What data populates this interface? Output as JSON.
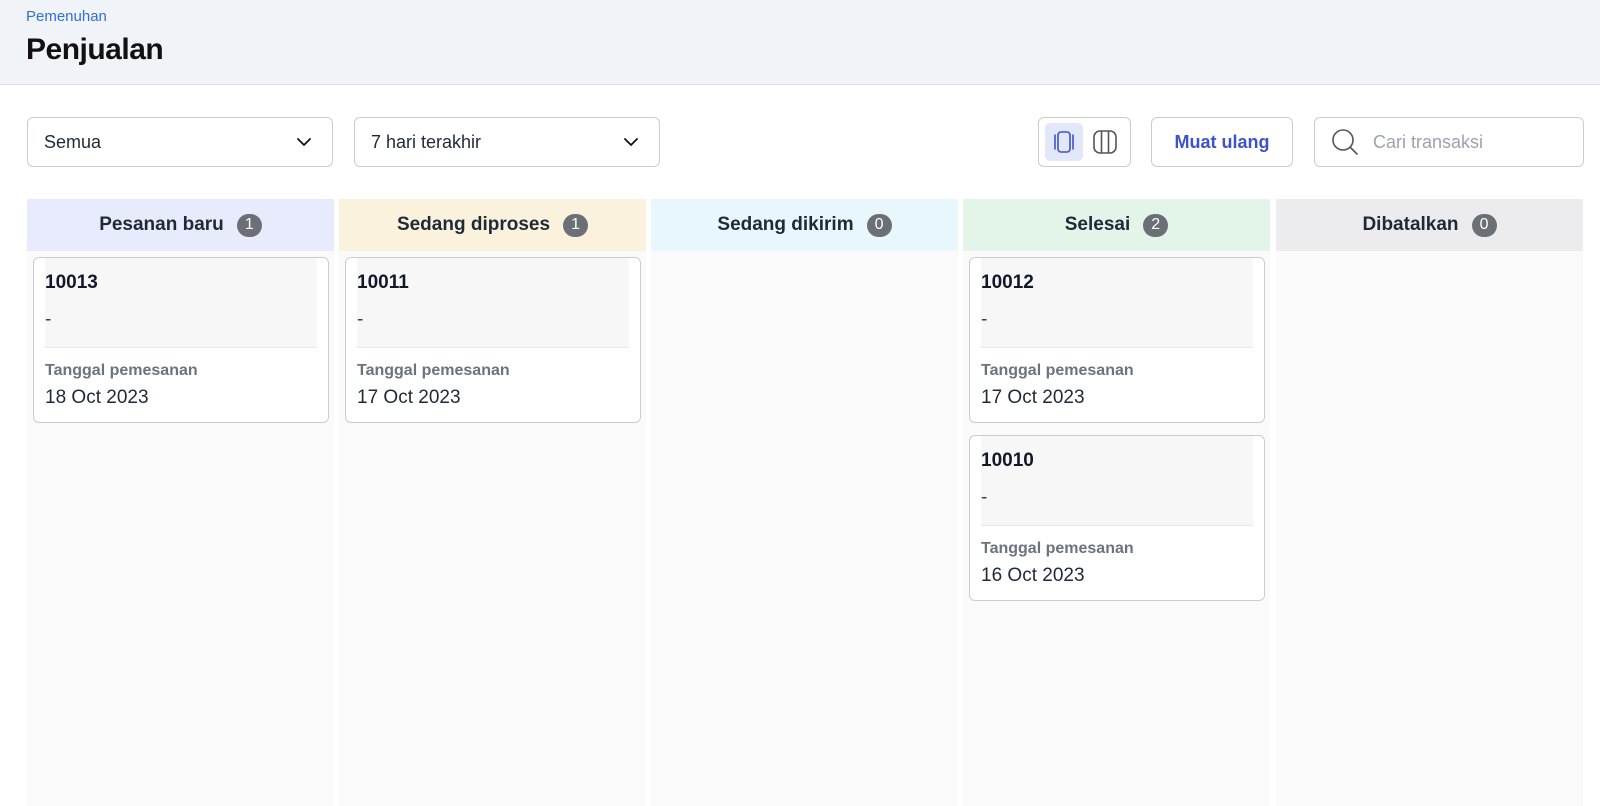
{
  "header": {
    "breadcrumb": "Pemenuhan",
    "title": "Penjualan"
  },
  "toolbar": {
    "status_filter": "Semua",
    "date_filter": "7 hari terakhir",
    "reload_label": "Muat ulang",
    "search_placeholder": "Cari transaksi",
    "view_modes": [
      {
        "icon": "card-view-icon",
        "active": true
      },
      {
        "icon": "column-view-icon",
        "active": false
      }
    ]
  },
  "colors": {
    "accent": "#3d53c9",
    "link": "#2f6fe0",
    "new": "#e8ebfc",
    "processing": "#fbf2de",
    "shipping": "#e8f7fb",
    "done": "#e3f4e8",
    "cancelled": "#ececee"
  },
  "board": {
    "columns": [
      {
        "title": "Pesanan baru",
        "count": "1",
        "color": "#e8ebfc",
        "cards": [
          {
            "id": "10013",
            "customer": "-",
            "date_label": "Tanggal pemesanan",
            "date": "18 Oct 2023"
          }
        ]
      },
      {
        "title": "Sedang diproses",
        "count": "1",
        "color": "#fbf2de",
        "cards": [
          {
            "id": "10011",
            "customer": "-",
            "date_label": "Tanggal pemesanan",
            "date": "17 Oct 2023"
          }
        ]
      },
      {
        "title": "Sedang dikirim",
        "count": "0",
        "color": "#e8f7fb",
        "cards": []
      },
      {
        "title": "Selesai",
        "count": "2",
        "color": "#e3f4e8",
        "cards": [
          {
            "id": "10012",
            "customer": "-",
            "date_label": "Tanggal pemesanan",
            "date": "17 Oct 2023"
          },
          {
            "id": "10010",
            "customer": "-",
            "date_label": "Tanggal pemesanan",
            "date": "16 Oct 2023"
          }
        ]
      },
      {
        "title": "Dibatalkan",
        "count": "0",
        "color": "#ececee",
        "cards": []
      }
    ]
  }
}
